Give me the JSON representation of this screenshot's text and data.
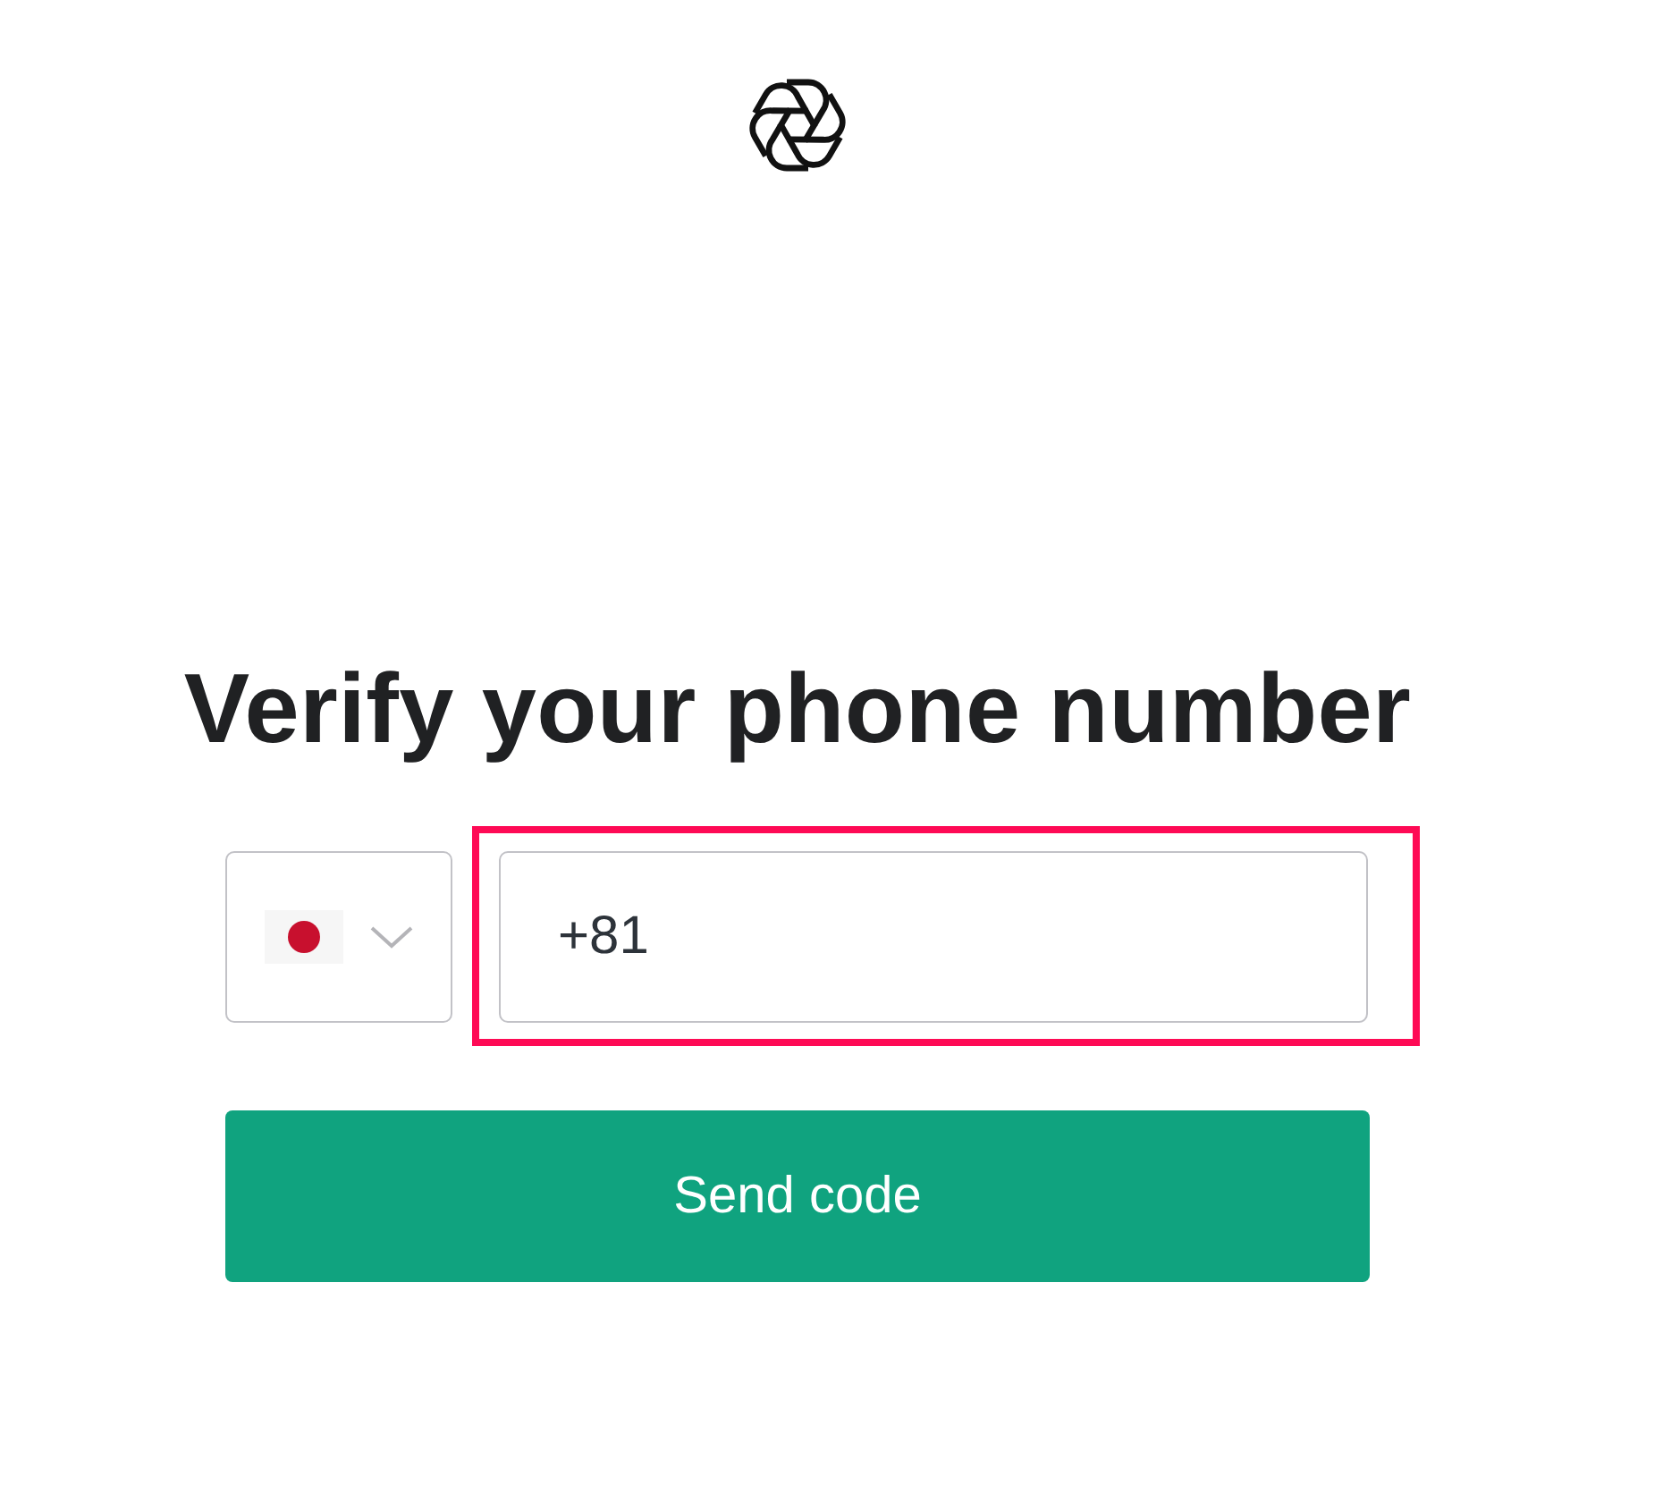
{
  "heading": "Verify your phone number",
  "phone_field": {
    "value": "+81",
    "highlighted": true
  },
  "send_button": {
    "label": "Send code"
  }
}
